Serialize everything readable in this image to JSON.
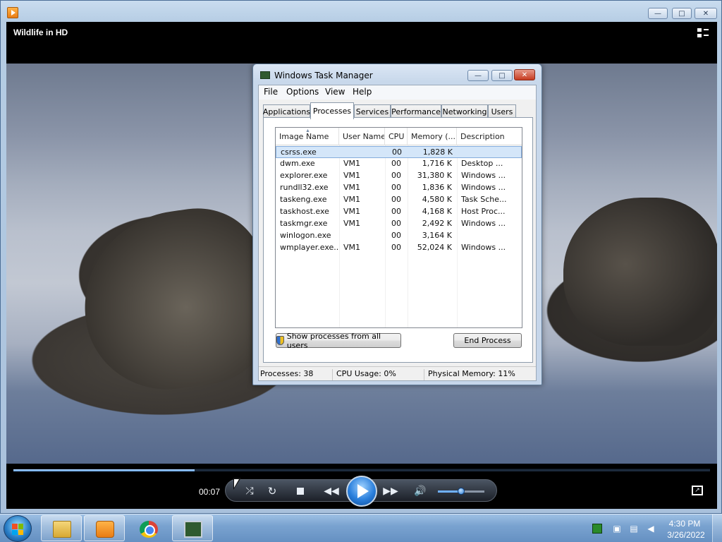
{
  "media_player": {
    "title": "Wildlife in HD",
    "time": "00:07",
    "seek_progress": 0.26,
    "volume": 0.5,
    "icons": {
      "app": "wmp-app-icon",
      "switch_library": "switch-to-library-icon",
      "shuffle": "shuffle-icon",
      "repeat": "repeat-icon",
      "stop": "stop-icon",
      "previous": "previous-icon",
      "play": "play-icon",
      "next": "next-icon",
      "mute": "speaker-icon",
      "fullscreen": "fullscreen-icon"
    },
    "glyphs": {
      "shuffle": "⤮",
      "repeat": "↻",
      "previous": "◀◀",
      "next": "▶▶",
      "mute": "🔊",
      "fullscreen": "↗",
      "minimize": "—",
      "maximize": "□",
      "close": "✕"
    }
  },
  "task_manager": {
    "title": "Windows Task Manager",
    "menu": [
      "File",
      "Options",
      "View",
      "Help"
    ],
    "tabs": [
      "Applications",
      "Processes",
      "Services",
      "Performance",
      "Networking",
      "Users"
    ],
    "active_tab": "Processes",
    "columns": [
      "Image Name",
      "User Name",
      "CPU",
      "Memory (...",
      "Description"
    ],
    "processes": [
      {
        "name": "csrss.exe",
        "user": "",
        "cpu": "00",
        "memory": "1,828 K",
        "description": ""
      },
      {
        "name": "dwm.exe",
        "user": "VM1",
        "cpu": "00",
        "memory": "1,716 K",
        "description": "Desktop ..."
      },
      {
        "name": "explorer.exe",
        "user": "VM1",
        "cpu": "00",
        "memory": "31,380 K",
        "description": "Windows ..."
      },
      {
        "name": "rundll32.exe",
        "user": "VM1",
        "cpu": "00",
        "memory": "1,836 K",
        "description": "Windows ..."
      },
      {
        "name": "taskeng.exe",
        "user": "VM1",
        "cpu": "00",
        "memory": "4,580 K",
        "description": "Task Sche..."
      },
      {
        "name": "taskhost.exe",
        "user": "VM1",
        "cpu": "00",
        "memory": "4,168 K",
        "description": "Host Proc..."
      },
      {
        "name": "taskmgr.exe",
        "user": "VM1",
        "cpu": "00",
        "memory": "2,492 K",
        "description": "Windows ..."
      },
      {
        "name": "winlogon.exe",
        "user": "",
        "cpu": "00",
        "memory": "3,164 K",
        "description": ""
      },
      {
        "name": "wmplayer.exe...",
        "user": "VM1",
        "cpu": "00",
        "memory": "52,024 K",
        "description": "Windows ..."
      }
    ],
    "selected_row": 0,
    "buttons": {
      "show_all": "Show processes from all users",
      "end_process": "End Process"
    },
    "status": {
      "processes": "Processes: 38",
      "cpu": "CPU Usage: 0%",
      "memory": "Physical Memory: 11%"
    },
    "icons": {
      "shield": "uac-shield-icon",
      "app": "task-manager-icon"
    }
  },
  "taskbar": {
    "apps": [
      {
        "name": "windows-explorer",
        "icon": "folder-icon"
      },
      {
        "name": "windows-media-player",
        "icon": "wmp-icon"
      },
      {
        "name": "google-chrome",
        "icon": "chrome-icon"
      },
      {
        "name": "task-manager",
        "icon": "task-manager-icon"
      }
    ],
    "tray_icons": [
      "action-center-icon",
      "network-icon",
      "volume-icon"
    ],
    "clock_time": "4:30 PM",
    "clock_date": "3/26/2022"
  }
}
